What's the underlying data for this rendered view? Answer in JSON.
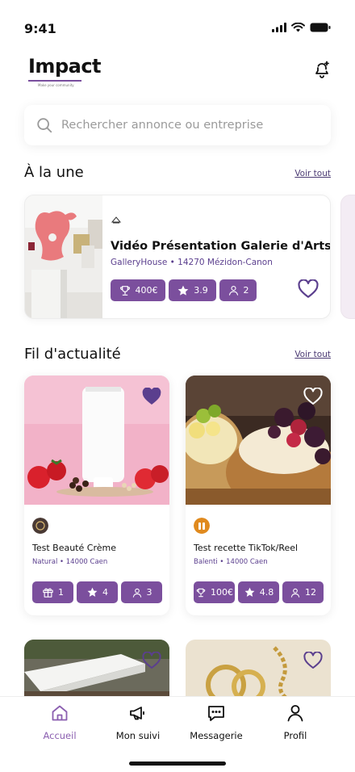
{
  "status": {
    "time": "9:41"
  },
  "header": {
    "logo": "Impact",
    "tagline": "Make your community",
    "bell_icon": "bell-plus-icon"
  },
  "search": {
    "placeholder": "Rechercher annonce ou entreprise"
  },
  "featured": {
    "title": "À la une",
    "see_all": "Voir tout",
    "card": {
      "title": "Vidéo Présentation Galerie d'Arts",
      "subtitle": "GalleryHouse • 14270 Mézidon-Canon",
      "badges": [
        {
          "icon": "trophy-icon",
          "value": "400€"
        },
        {
          "icon": "star-icon",
          "value": "3.9"
        },
        {
          "icon": "user-icon",
          "value": "2"
        }
      ]
    }
  },
  "feed": {
    "title": "Fil d'actualité",
    "see_all": "Voir tout",
    "cards": [
      {
        "title": "Test Beauté Crème",
        "subtitle": "Natural • 14000 Caen",
        "liked": true,
        "badges": [
          {
            "icon": "gift-icon",
            "value": "1"
          },
          {
            "icon": "star-icon",
            "value": "4"
          },
          {
            "icon": "user-icon",
            "value": "3"
          }
        ]
      },
      {
        "title": "Test recette TikTok/Reel",
        "subtitle": "Balenti • 14000 Caen",
        "liked": false,
        "badges": [
          {
            "icon": "trophy-icon",
            "value": "100€"
          },
          {
            "icon": "star-icon",
            "value": "4.8"
          },
          {
            "icon": "user-icon",
            "value": "12"
          }
        ]
      }
    ]
  },
  "nav": {
    "items": [
      {
        "label": "Accueil",
        "icon": "home-icon",
        "active": true
      },
      {
        "label": "Mon suivi",
        "icon": "megaphone-icon",
        "active": false
      },
      {
        "label": "Messagerie",
        "icon": "message-icon",
        "active": false
      },
      {
        "label": "Profil",
        "icon": "user-icon",
        "active": false
      }
    ]
  },
  "colors": {
    "accent": "#7b4f9d",
    "accent_text": "#5b3f8e",
    "nav_active": "#8b5fb0"
  }
}
